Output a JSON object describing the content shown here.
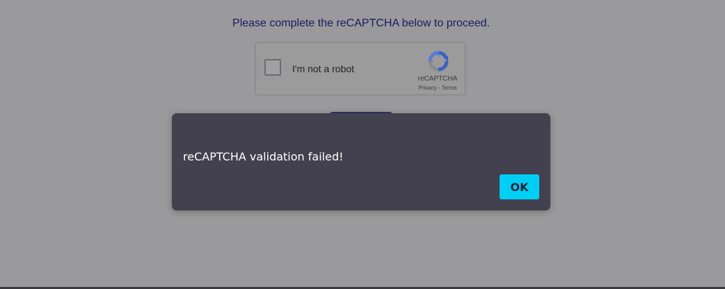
{
  "page": {
    "instruction": "Please complete the reCAPTCHA below to proceed."
  },
  "recaptcha": {
    "checkbox_label": "I'm not a robot",
    "brand": "reCAPTCHA",
    "privacy_link": "Privacy",
    "separator": " - ",
    "terms_link": "Terms"
  },
  "dialog": {
    "message": "reCAPTCHA validation failed!",
    "ok_label": "OK"
  },
  "colors": {
    "page_background": "#9a999b",
    "instruction_text": "#1a1a66",
    "dialog_background": "#43414f",
    "ok_button": "#00cff5",
    "recaptcha_logo_blue": "#3b61c8",
    "recaptcha_logo_gray": "#8a8a8c"
  },
  "icons": {
    "recaptcha_logo": "recaptcha-logo-icon"
  }
}
